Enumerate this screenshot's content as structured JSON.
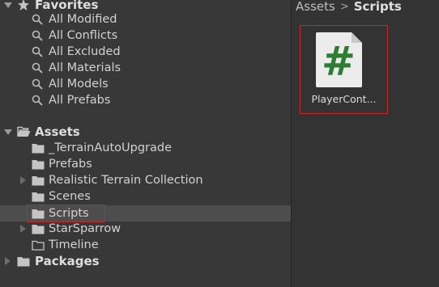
{
  "tree": {
    "favorites": {
      "label": "Favorites",
      "items": [
        {
          "label": "All Modified"
        },
        {
          "label": "All Conflicts"
        },
        {
          "label": "All Excluded"
        },
        {
          "label": "All Materials"
        },
        {
          "label": "All Models"
        },
        {
          "label": "All Prefabs"
        }
      ]
    },
    "assets": {
      "label": "Assets",
      "items": [
        {
          "label": "_TerrainAutoUpgrade"
        },
        {
          "label": "Prefabs"
        },
        {
          "label": "Realistic Terrain Collection"
        },
        {
          "label": "Scenes"
        },
        {
          "label": "Scripts"
        },
        {
          "label": "StarSparrow"
        },
        {
          "label": "Timeline"
        }
      ]
    },
    "packages": {
      "label": "Packages"
    }
  },
  "breadcrumb": {
    "root": "Assets",
    "separator": ">",
    "current": "Scripts"
  },
  "assets_view": {
    "items": [
      {
        "name": "PlayerCont...",
        "icon_glyph": "#",
        "icon": "csharp-script-icon"
      }
    ]
  },
  "colors": {
    "selection_outline": "#c8262c",
    "script_glyph": "#2e7d32"
  }
}
